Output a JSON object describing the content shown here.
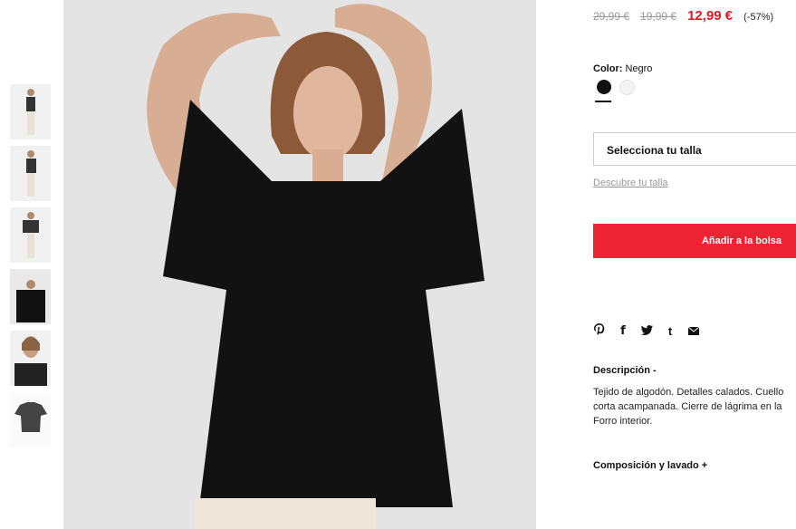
{
  "product": {
    "old_price_1": "29,99 €",
    "old_price_2": "19,99 €",
    "price": "12,99 €",
    "discount": "(-57%)"
  },
  "color": {
    "label": "Color:",
    "selected": "Negro",
    "swatches": [
      {
        "name": "black",
        "hex": "#111111"
      },
      {
        "name": "white",
        "hex": "#f3f3f3"
      }
    ]
  },
  "size": {
    "select_label": "Selecciona tu talla",
    "guide_link": "Descubre tu talla"
  },
  "cart": {
    "add_label": "Añadir a la bolsa"
  },
  "share": {
    "icons": [
      "pinterest-icon",
      "facebook-icon",
      "twitter-icon",
      "tumblr-icon",
      "email-icon"
    ],
    "glyphs": [
      "℗",
      "f",
      "🐦",
      "t",
      "✉"
    ]
  },
  "description": {
    "title": "Descripción -",
    "line1": "Tejido de algodón. Detalles calados. Cuello",
    "line2": "corta acampanada. Cierre de lágrima en la",
    "line3": "Forro interior."
  },
  "composition": {
    "title": "Composición y lavado +"
  },
  "colors": {
    "accent": "#ee2334",
    "sale": "#e3171e"
  }
}
